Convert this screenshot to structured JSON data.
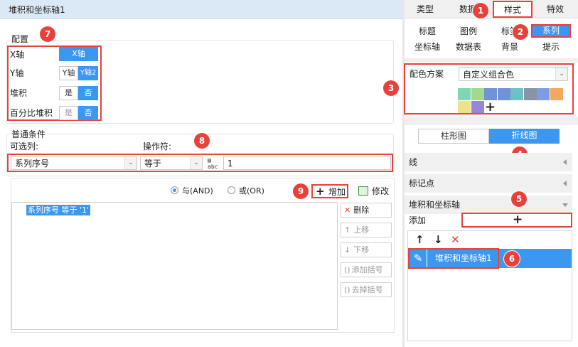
{
  "title_bar": {
    "title": "堆积和坐标轴1"
  },
  "config": {
    "section_label": "配置",
    "rows": [
      {
        "label": "X轴",
        "options": [
          "X轴"
        ],
        "selected": 0
      },
      {
        "label": "Y轴",
        "options": [
          "Y轴",
          "Y轴2"
        ],
        "selected": 1
      },
      {
        "label": "堆积",
        "options": [
          "是",
          "否"
        ],
        "selected": 1
      },
      {
        "label": "百分比堆积",
        "options": [
          "是",
          "否"
        ],
        "selected": 1
      }
    ]
  },
  "condition": {
    "section_label": "普通条件",
    "column_label": "可选列:",
    "operator_label": "操作符:",
    "column_value": "系列序号",
    "operator_value": "等于",
    "value_input": "1",
    "and_label": "与(AND)",
    "or_label": "或(OR)",
    "add_label": "增加",
    "edit_label": "修改",
    "expression": "系列序号 等于 '1'",
    "side_buttons": {
      "delete": "删除",
      "up": "上移",
      "down": "下移",
      "add_bracket": "添加括号",
      "remove_bracket": "去掉括号"
    }
  },
  "right": {
    "top_tabs": [
      "类型",
      "数据",
      "样式",
      "特效"
    ],
    "sub_tabs_row1": [
      "标题",
      "图例",
      "标签",
      "系列"
    ],
    "sub_tabs_row2": [
      "坐标轴",
      "数据表",
      "背景",
      "提示"
    ],
    "color_scheme_label": "配色方案",
    "color_scheme_value": "自定义组合色",
    "colors_row1": [
      "#7ed6b4",
      "#a2d98a",
      "#6f93d6",
      "#6f93d6",
      "#6fbfc6",
      "#8a94a8",
      "#7d9ce3",
      "#f2a860"
    ],
    "colors_row2": [
      "#ede18a",
      "#9a86d8"
    ],
    "chart_type_tabs": [
      "柱形图",
      "折线图"
    ],
    "line_section": "线",
    "marker_section": "标记点",
    "stack_section": "堆积和坐标轴",
    "add_label": "添加",
    "list_item": "堆积和坐标轴1"
  },
  "badges": [
    "1",
    "2",
    "3",
    "4",
    "5",
    "6",
    "7",
    "8",
    "9"
  ],
  "colors": {
    "accent": "#3b97f0",
    "annotation": "#e8413c",
    "title_bg": "#dbe9f7"
  }
}
